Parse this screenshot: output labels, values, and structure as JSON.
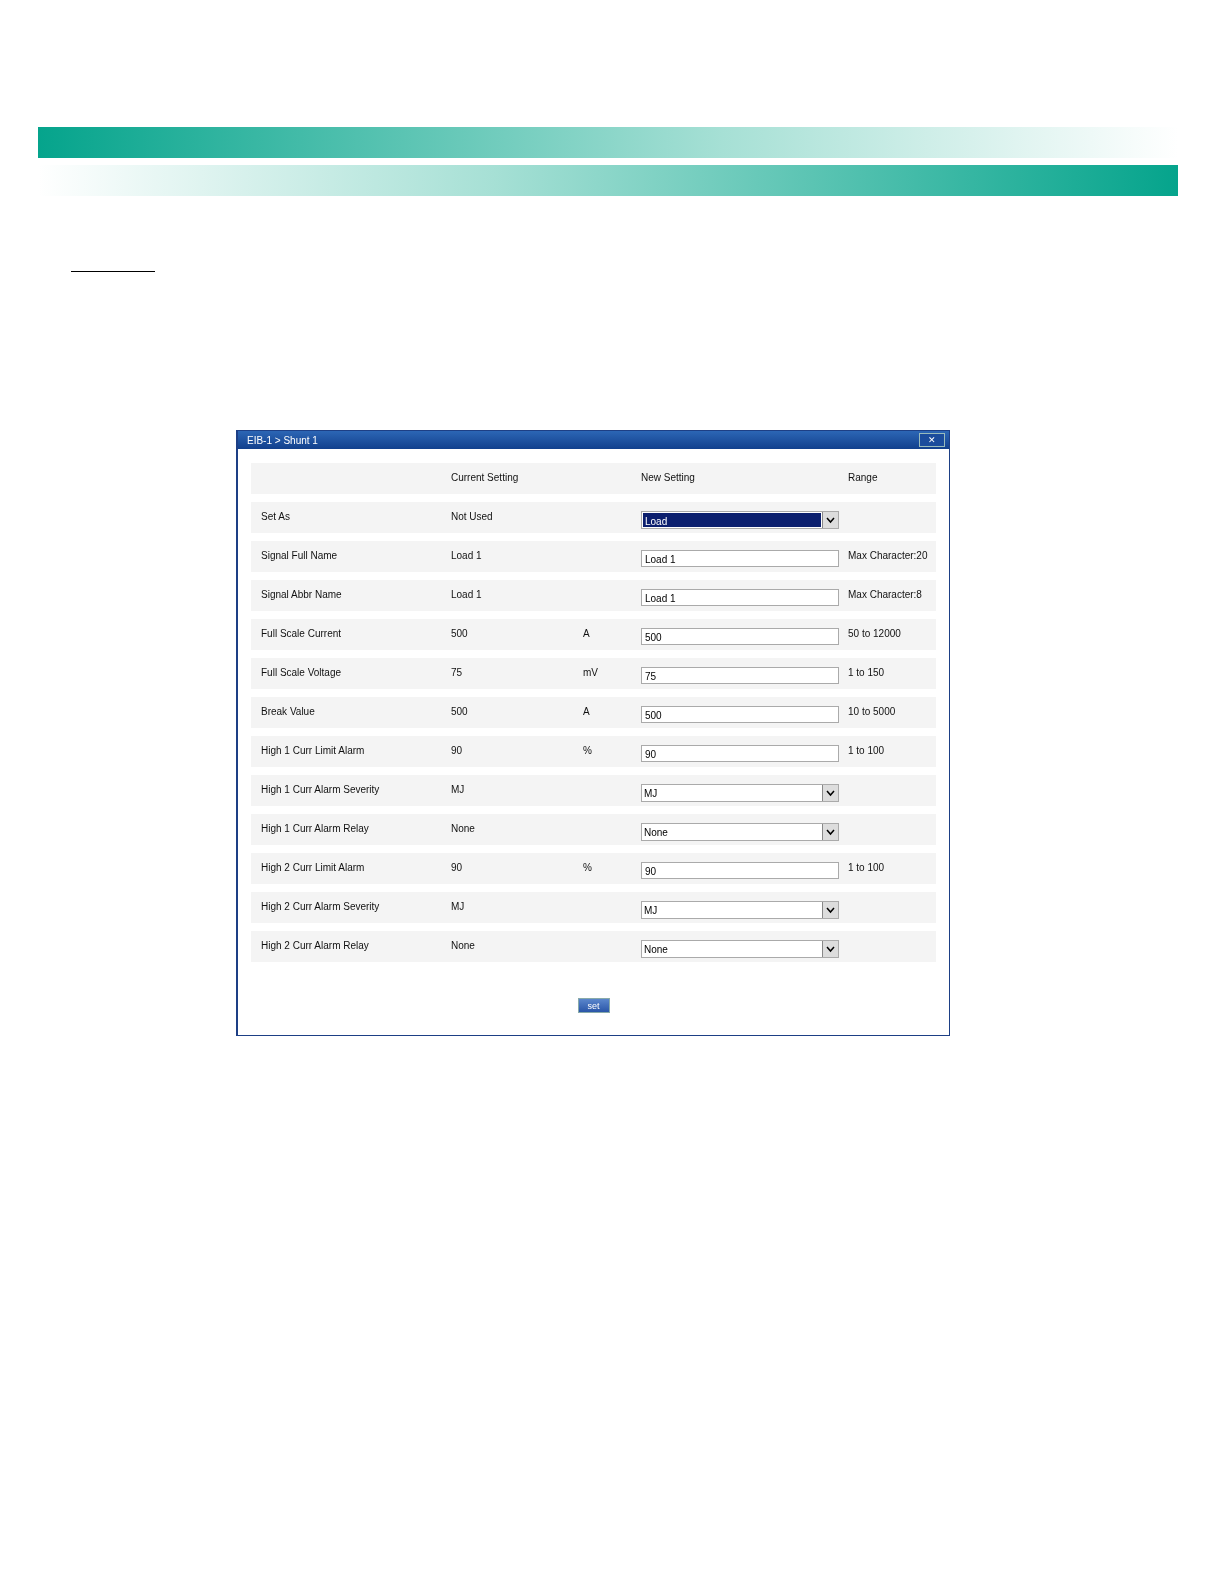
{
  "dialog": {
    "title": "EIB-1 > Shunt 1",
    "close": "✕",
    "columns": [
      "Current Setting",
      "New Setting",
      "Range"
    ],
    "rows": [
      {
        "label": "Set As",
        "current": "Not Used",
        "kind": "select",
        "value": "Load",
        "highlighted": true
      },
      {
        "label": "Signal Full Name",
        "current": "Load 1",
        "kind": "text",
        "value": "Load 1",
        "range": "Max Character:20"
      },
      {
        "label": "Signal Abbr Name",
        "current": "Load 1",
        "kind": "text",
        "value": "Load 1",
        "range": "Max Character:8"
      },
      {
        "label": "Full Scale Current",
        "current": "500",
        "unit": "A",
        "kind": "text",
        "value": "500",
        "range": "50 to 12000"
      },
      {
        "label": "Full Scale Voltage",
        "current": "75",
        "unit": "mV",
        "kind": "text",
        "value": "75",
        "range": "1 to 150"
      },
      {
        "label": "Break Value",
        "current": "500",
        "unit": "A",
        "kind": "text",
        "value": "500",
        "range": "10 to 5000"
      },
      {
        "label": "High 1 Curr Limit Alarm",
        "current": "90",
        "unit": "%",
        "kind": "text",
        "value": "90",
        "range": "1 to 100"
      },
      {
        "label": "High 1 Curr Alarm Severity",
        "current": "MJ",
        "kind": "select",
        "value": "MJ",
        "highlighted": false
      },
      {
        "label": "High 1 Curr Alarm Relay",
        "current": "None",
        "kind": "select",
        "value": "None",
        "highlighted": false
      },
      {
        "label": "High 2 Curr Limit Alarm",
        "current": "90",
        "unit": "%",
        "kind": "text",
        "value": "90",
        "range": "1 to 100"
      },
      {
        "label": "High 2 Curr Alarm Severity",
        "current": "MJ",
        "kind": "select",
        "value": "MJ",
        "highlighted": false
      },
      {
        "label": "High 2 Curr Alarm Relay",
        "current": "None",
        "kind": "select",
        "value": "None",
        "highlighted": false
      }
    ],
    "button": "set"
  }
}
